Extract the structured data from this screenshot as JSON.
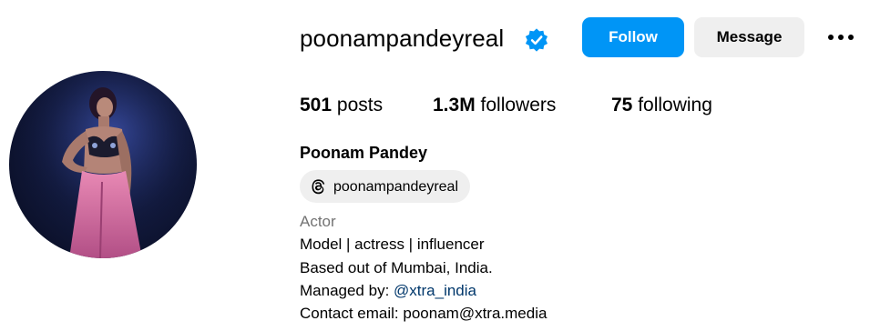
{
  "profile": {
    "username": "poonampandeyreal",
    "verified": true,
    "full_name": "Poonam Pandey",
    "avatar_icon": "profile-photo"
  },
  "actions": {
    "follow_label": "Follow",
    "message_label": "Message",
    "more_icon": "more-options-icon"
  },
  "stats": {
    "posts_count": "501",
    "posts_label": "posts",
    "followers_count": "1.3M",
    "followers_label": "followers",
    "following_count": "75",
    "following_label": "following"
  },
  "threads": {
    "icon": "threads-icon",
    "handle": "poonampandeyreal"
  },
  "bio": {
    "category": "Actor",
    "line1": "Model | actress | influencer",
    "line2": "Based out of Mumbai, India.",
    "line3_prefix": "Managed by: ",
    "line3_link": "@xtra_india",
    "line4": "Contact email: poonam@xtra.media"
  },
  "colors": {
    "follow_button": "#0095f6",
    "secondary_button": "#efefef",
    "verified_badge": "#0095f6",
    "link": "#00376b",
    "category_text": "#737373"
  }
}
